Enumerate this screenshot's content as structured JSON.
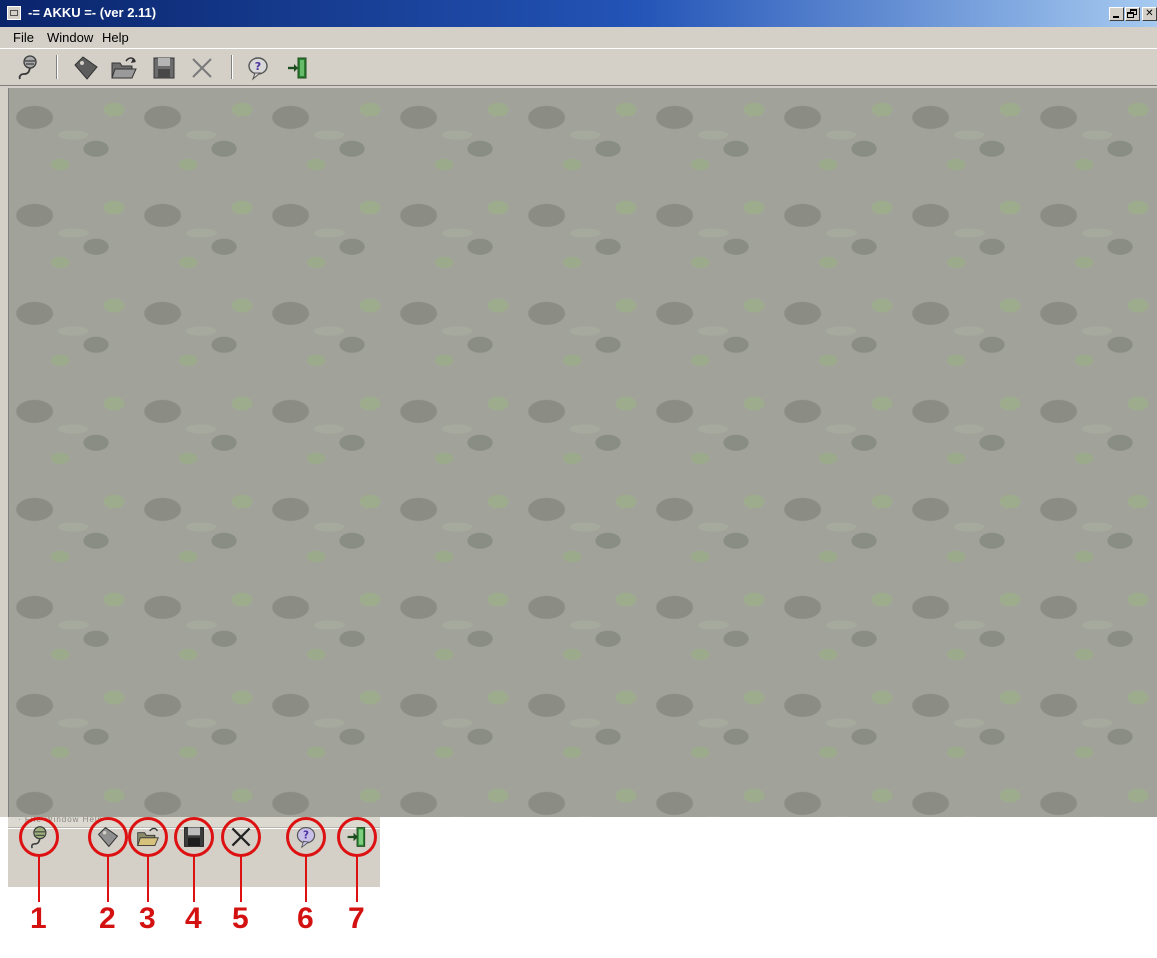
{
  "window": {
    "title": "-= AKKU =- (ver 2.11)",
    "caption_buttons": {
      "minimize": "",
      "maximize": "",
      "close": "✕"
    }
  },
  "menu": {
    "items": [
      "File",
      "Window",
      "Help"
    ]
  },
  "toolbar": {
    "buttons": [
      {
        "id": 1,
        "icon": "connect-icon"
      },
      {
        "id": 2,
        "icon": "tag-icon"
      },
      {
        "id": 3,
        "icon": "open-folder-icon"
      },
      {
        "id": 4,
        "icon": "save-disk-icon"
      },
      {
        "id": 5,
        "icon": "delete-x-icon"
      },
      {
        "id": 6,
        "icon": "help-icon"
      },
      {
        "id": 7,
        "icon": "exit-door-icon"
      }
    ]
  },
  "callouts": {
    "labels": [
      "1",
      "2",
      "3",
      "4",
      "5",
      "6",
      "7"
    ],
    "color": "#dd1111"
  },
  "colors": {
    "titlebar_start": "#0a246a",
    "titlebar_end": "#a6caf0",
    "window_face": "#d4d0c8",
    "workspace": "#a1a39a"
  }
}
